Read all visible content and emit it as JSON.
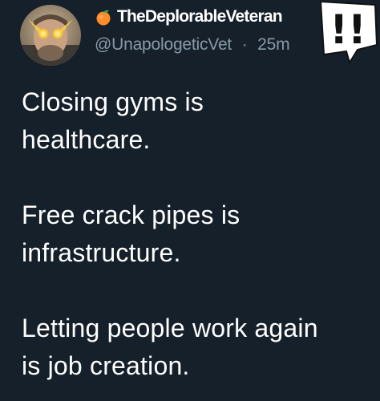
{
  "author": {
    "display_name": "TheDeplorableVeteran",
    "handle": "@UnapologeticVet",
    "separator": "·",
    "timestamp": "25m",
    "name_prefix_icon": "peach-emoji-icon",
    "avatar_icon": "profile-photo-laser-eyes"
  },
  "badge": {
    "icon": "double-exclamation-icon",
    "text": "!!"
  },
  "tweet": {
    "paragraphs": [
      "Closing gyms is\nhealthcare.",
      "Free crack pipes is\ninfrastructure.",
      "Letting people work again\nis job creation."
    ]
  },
  "colors": {
    "background": "#15202b",
    "text_primary": "#ffffff",
    "text_secondary": "#8899a6",
    "laser_eyes": "#ffd54a"
  }
}
